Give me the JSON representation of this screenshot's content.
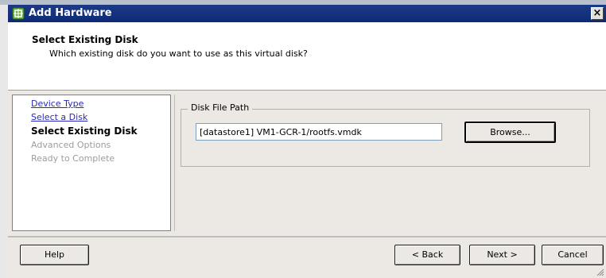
{
  "window": {
    "title": "Add Hardware",
    "close_label": "×"
  },
  "header": {
    "title": "Select Existing Disk",
    "subtitle": "Which existing disk do you want to use as this virtual disk?"
  },
  "steps": [
    {
      "label": "Device Type",
      "state": "link"
    },
    {
      "label": "Select a Disk",
      "state": "link"
    },
    {
      "label": "Select Existing Disk",
      "state": "current"
    },
    {
      "label": "Advanced Options",
      "state": "disabled"
    },
    {
      "label": "Ready to Complete",
      "state": "disabled"
    }
  ],
  "disk_path": {
    "group_label": "Disk File Path",
    "value": "[datastore1] VM1-GCR-1/rootfs.vmdk",
    "browse_label": "Browse..."
  },
  "footer": {
    "help_label": "Help",
    "back_label": "< Back",
    "next_label": "Next >",
    "cancel_label": "Cancel"
  },
  "colors": {
    "title_bar": "#0d2a76",
    "link": "#2a2ab8",
    "disabled_text": "#9c9c9c"
  }
}
